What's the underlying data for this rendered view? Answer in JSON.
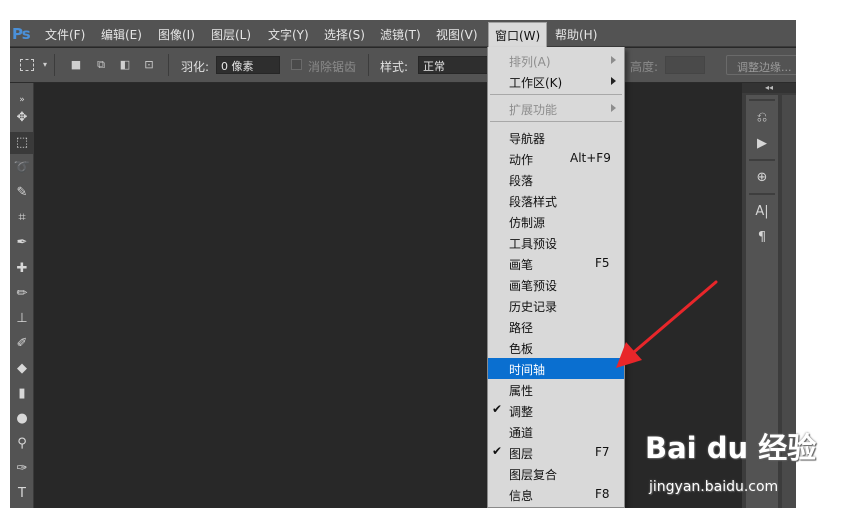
{
  "app": {
    "logo": "Ps"
  },
  "menubar": {
    "items": [
      "文件(F)",
      "编辑(E)",
      "图像(I)",
      "图层(L)",
      "文字(Y)",
      "选择(S)",
      "滤镜(T)",
      "视图(V)",
      "窗口(W)",
      "帮助(H)"
    ],
    "active": "窗口(W)"
  },
  "options": {
    "feather_label": "羽化:",
    "feather_value": "0 像素",
    "antialias_label": "消除锯齿",
    "style_label": "样式:",
    "style_value": "正常",
    "height_label": "高度:",
    "refine_edge_button": "调整边缘..."
  },
  "window_menu": {
    "items": [
      {
        "label": "排列(A)",
        "submenu": true,
        "disabled": true
      },
      {
        "label": "工作区(K)",
        "submenu": true
      },
      {
        "label": "扩展功能",
        "submenu": true,
        "disabled": true
      },
      {
        "label": "导航器"
      },
      {
        "label": "动作",
        "shortcut": "Alt+F9"
      },
      {
        "label": "段落"
      },
      {
        "label": "段落样式"
      },
      {
        "label": "仿制源"
      },
      {
        "label": "工具预设"
      },
      {
        "label": "画笔",
        "shortcut": "F5"
      },
      {
        "label": "画笔预设"
      },
      {
        "label": "历史记录"
      },
      {
        "label": "路径"
      },
      {
        "label": "色板"
      },
      {
        "label": "时间轴",
        "highlighted": true
      },
      {
        "label": "属性"
      },
      {
        "label": "调整",
        "checked": true
      },
      {
        "label": "通道"
      },
      {
        "label": "图层",
        "shortcut": "F7",
        "checked": true
      },
      {
        "label": "图层复合"
      },
      {
        "label": "信息",
        "shortcut": "F8"
      }
    ]
  },
  "watermark": {
    "logo_text": "Bai du 经验",
    "url": "jingyan.baidu.com"
  },
  "colors": {
    "highlight": "#0a6fd0",
    "annotation_arrow": "#e8262a"
  }
}
